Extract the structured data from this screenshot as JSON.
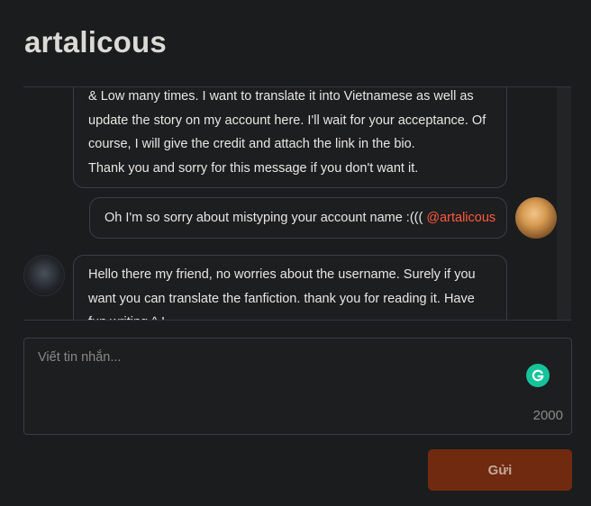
{
  "header": {
    "title": "artalicous"
  },
  "messages": [
    {
      "sender": "other",
      "lines": [
        "& Low many times. I want to translate it into Vietnamese as well as",
        "update the story on my account here. I'll wait for your acceptance. Of",
        "course, I will give the credit and attach the link in the bio.",
        "Thank you and sorry for this message if you don't want it."
      ]
    },
    {
      "sender": "me",
      "text": "Oh I'm so sorry about mistyping your account name :(((",
      "mention": "@artalicous"
    },
    {
      "sender": "other",
      "lines": [
        "Hello there my friend, no worries about the username. Surely if you",
        "want you can translate the fanfiction.  thank you for reading it. Have",
        "fun writing ^ !"
      ]
    }
  ],
  "composer": {
    "placeholder": "Viết tin nhắn...",
    "counter": "2000"
  },
  "send_button": {
    "label": "Gửi"
  },
  "colors": {
    "background": "#1b1c1e",
    "mention": "#ff5a3c",
    "send_button": "#6f2a10",
    "grammarly": "#15c39a"
  }
}
